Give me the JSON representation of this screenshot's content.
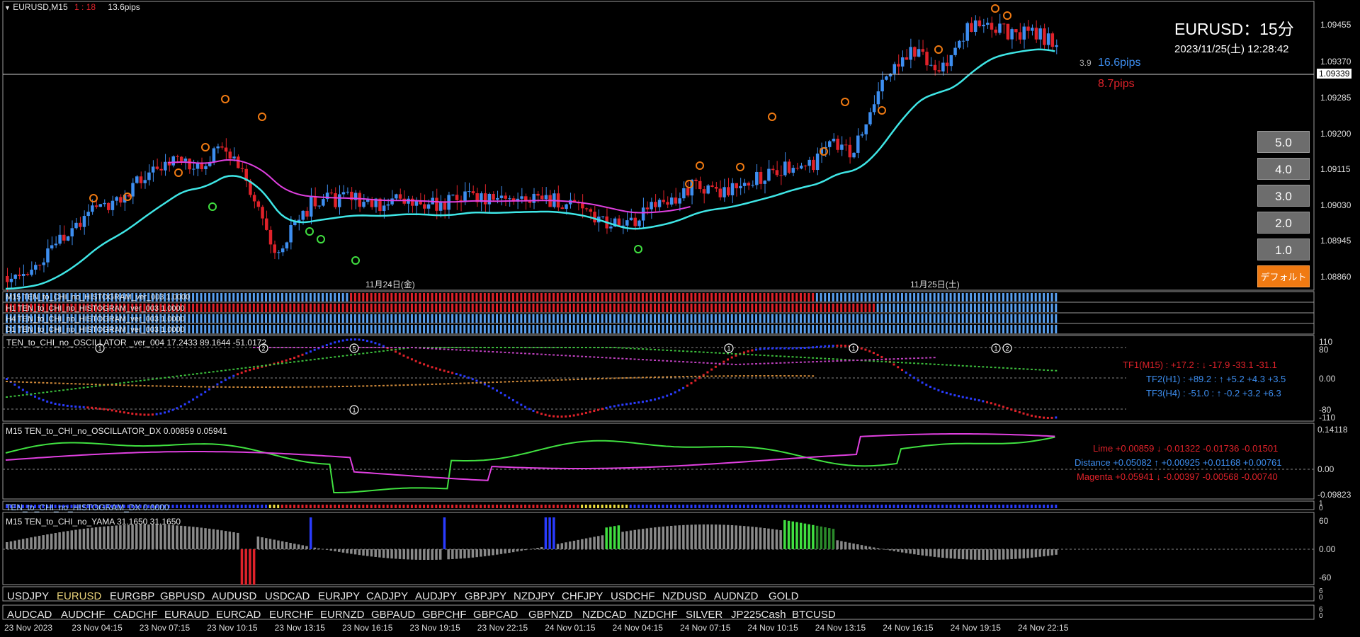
{
  "header": {
    "symbol": "EURUSD,M15",
    "countdown_a": "1",
    "countdown_sep": ":",
    "countdown_b": "18",
    "spread": "13.6pips"
  },
  "overlay": {
    "title": "EURUSD：15分",
    "datetime": "2023/11/25(土) 12:28:42",
    "line_value": "3.9",
    "pips_blue": "16.6pips",
    "pips_red": "8.7pips"
  },
  "price_axis": {
    "labels": [
      "1.09455",
      "1.09370",
      "1.09285",
      "1.09200",
      "1.09115",
      "1.09030",
      "1.08945",
      "1.08860"
    ],
    "current": "1.09339"
  },
  "date_markers": [
    "11月24日(金)",
    "11月25日(土)"
  ],
  "buttons": [
    "5.0",
    "4.0",
    "3.0",
    "2.0",
    "1.0",
    "デフォルト"
  ],
  "histogram_rows": [
    "M15 TEN_to_CHI_no_HISTOGRAM_ver_003 1.0000",
    "H1 TEN_to_CHI_no_HISTOGRAM_ver_003 1.0000",
    "H4 TEN_to_CHI_no_HISTOGRAM_ver_003 1.0000",
    "D1 TEN_to_CHI_no_HISTOGRAM_ver_003 1.0000"
  ],
  "histogram_axis": [
    "1",
    "0"
  ],
  "oscillator": {
    "title": "TEN_to_CHI_no_OSCILLATOR _ver_004 17.2433 89.1644 -51.0172",
    "axis": [
      "110",
      "80",
      "0.00",
      "-80",
      "-110"
    ],
    "tf1": "TF1(M15) : +17.2 : ↓ -17.9 -33.1 -31.1",
    "tf2": "TF2(H1) : +89.2 : ↑ +5.2 +4.3 +3.5",
    "tf3": "TF3(H4) : -51.0 : ↑ -0.2 +3.2 +6.3",
    "circle_labels": [
      "1",
      "2",
      "5",
      "1",
      "1",
      "1",
      "1",
      "2"
    ]
  },
  "dx": {
    "title": "M15 TEN_to_CHI_no_OSCILLATOR_DX  0.00859 0.05941",
    "axis": [
      "0.14118",
      "0.00",
      "-0.09823"
    ],
    "lime": "Lime +0.00859 ↓ -0.01322 -0.01736 -0.01501",
    "distance": "Distance +0.05082 ↑ +0.00925 +0.01168 +0.00761",
    "magenta": "Magenta +0.05941 ↓ -0.00397 -0.00568 -0.00740"
  },
  "hist_dx": {
    "title": "TEN_to_CHI_no_HISTOGRAM_DX 0.0000",
    "axis": [
      "1",
      "0"
    ]
  },
  "yama": {
    "title": "M15  TEN_to_CHI_no_YAMA  31.1650 31.1650",
    "axis": [
      "60",
      "0.00",
      "-60"
    ]
  },
  "symbols_row1": [
    "USDJPY",
    "EURUSD",
    "EURGBP",
    "GBPUSD",
    "AUDUSD",
    "USDCAD",
    "EURJPY",
    "CADJPY",
    "AUDJPY",
    "GBPJPY",
    "NZDJPY",
    "CHFJPY",
    "USDCHF",
    "NZDUSD",
    "AUDNZD",
    "GOLD"
  ],
  "symbols_row2": [
    "AUDCAD",
    "AUDCHF",
    "CADCHF",
    "EURAUD",
    "EURCAD",
    "EURCHF",
    "EURNZD",
    "GBPAUD",
    "GBPCHF",
    "GBPCAD",
    "GBPNZD",
    "NZDCAD",
    "NZDCHF",
    "SILVER",
    "JP225Cash",
    "BTCUSD"
  ],
  "symbols_axis": [
    "6",
    "0"
  ],
  "time_axis": [
    "23 Nov 2023",
    "23 Nov 04:15",
    "23 Nov 07:15",
    "23 Nov 10:15",
    "23 Nov 13:15",
    "23 Nov 16:15",
    "23 Nov 19:15",
    "23 Nov 22:15",
    "24 Nov 01:15",
    "24 Nov 04:15",
    "24 Nov 07:15",
    "24 Nov 10:15",
    "24 Nov 13:15",
    "24 Nov 16:15",
    "24 Nov 19:15",
    "24 Nov 22:15"
  ],
  "colors": {
    "bull": "#3d8ef0",
    "bear": "#e0222a",
    "cyan_ma": "#3fe6e6",
    "magenta": "#e040e0",
    "lime": "#40e040",
    "orange": "#f07a12",
    "selected_symbol": "#e8d27a"
  }
}
